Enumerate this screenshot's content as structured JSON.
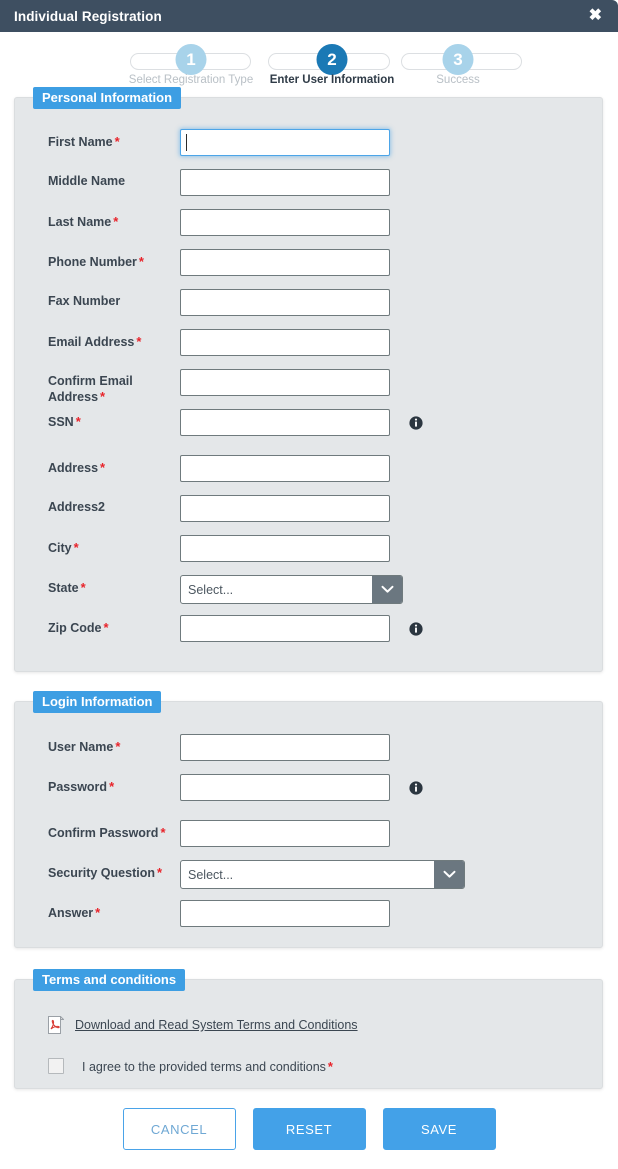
{
  "window": {
    "title": "Individual Registration",
    "close_label": "✖"
  },
  "stepper": {
    "steps": [
      {
        "number": "1",
        "label": "Select Registration Type",
        "state": "inactive"
      },
      {
        "number": "2",
        "label": "Enter User Information",
        "state": "active"
      },
      {
        "number": "3",
        "label": "Success",
        "state": "inactive"
      }
    ]
  },
  "personal_information": {
    "title": "Personal Information",
    "fields": [
      {
        "label": "First Name",
        "required": true,
        "type": "text",
        "value": "",
        "focused": true,
        "info": false
      },
      {
        "label": "Middle Name",
        "required": false,
        "type": "text",
        "value": "",
        "focused": false,
        "info": false
      },
      {
        "label": "Last Name",
        "required": true,
        "type": "text",
        "value": "",
        "focused": false,
        "info": false
      },
      {
        "label": "Phone Number",
        "required": true,
        "type": "text",
        "value": "",
        "focused": false,
        "info": false
      },
      {
        "label": "Fax Number",
        "required": false,
        "type": "text",
        "value": "",
        "focused": false,
        "info": false
      },
      {
        "label": "Email Address",
        "required": true,
        "type": "text",
        "value": "",
        "focused": false,
        "info": false
      },
      {
        "label": "Confirm Email Address",
        "required": true,
        "type": "text",
        "value": "",
        "focused": false,
        "info": false
      },
      {
        "label": "SSN",
        "required": true,
        "type": "text",
        "value": "",
        "focused": false,
        "info": true
      },
      {
        "label": "Address",
        "required": true,
        "type": "text",
        "value": "",
        "focused": false,
        "info": false
      },
      {
        "label": "Address2",
        "required": false,
        "type": "text",
        "value": "",
        "focused": false,
        "info": false
      },
      {
        "label": "City",
        "required": true,
        "type": "text",
        "value": "",
        "focused": false,
        "info": false
      },
      {
        "label": "State",
        "required": true,
        "type": "select",
        "value": "Select...",
        "focused": false,
        "info": false
      },
      {
        "label": "Zip Code",
        "required": true,
        "type": "text",
        "value": "",
        "focused": false,
        "info": true
      }
    ]
  },
  "login_information": {
    "title": "Login Information",
    "fields": [
      {
        "label": "User Name",
        "required": true,
        "type": "text",
        "value": "",
        "info": false
      },
      {
        "label": "Password",
        "required": true,
        "type": "text",
        "value": "",
        "info": true
      },
      {
        "label": "Confirm Password",
        "required": true,
        "type": "text",
        "value": "",
        "info": false
      },
      {
        "label": "Security Question",
        "required": true,
        "type": "select",
        "value": "Select...",
        "info": false
      },
      {
        "label": "Answer",
        "required": true,
        "type": "text",
        "value": "",
        "info": false
      }
    ]
  },
  "terms": {
    "title": "Terms and conditions",
    "download_link": "Download and Read System Terms and Conditions",
    "agree_label": "I agree to the provided terms and conditions",
    "agree_required": true,
    "agree_checked": false
  },
  "footer": {
    "cancel_label": "CANCEL",
    "reset_label": "RESET",
    "save_label": "SAVE"
  },
  "colors": {
    "titlebar": "#3e4f61",
    "accent": "#3d9ee3",
    "primary_button": "#43a1e8",
    "step_active": "#1b79b5",
    "step_inactive": "#a8d3ea",
    "panel_bg": "#e4e7e9",
    "required_star": "#e8232a"
  },
  "icons": {
    "close": "close-icon",
    "info": "info-icon",
    "chevron": "chevron-down-icon",
    "pdf": "pdf-file-icon"
  }
}
